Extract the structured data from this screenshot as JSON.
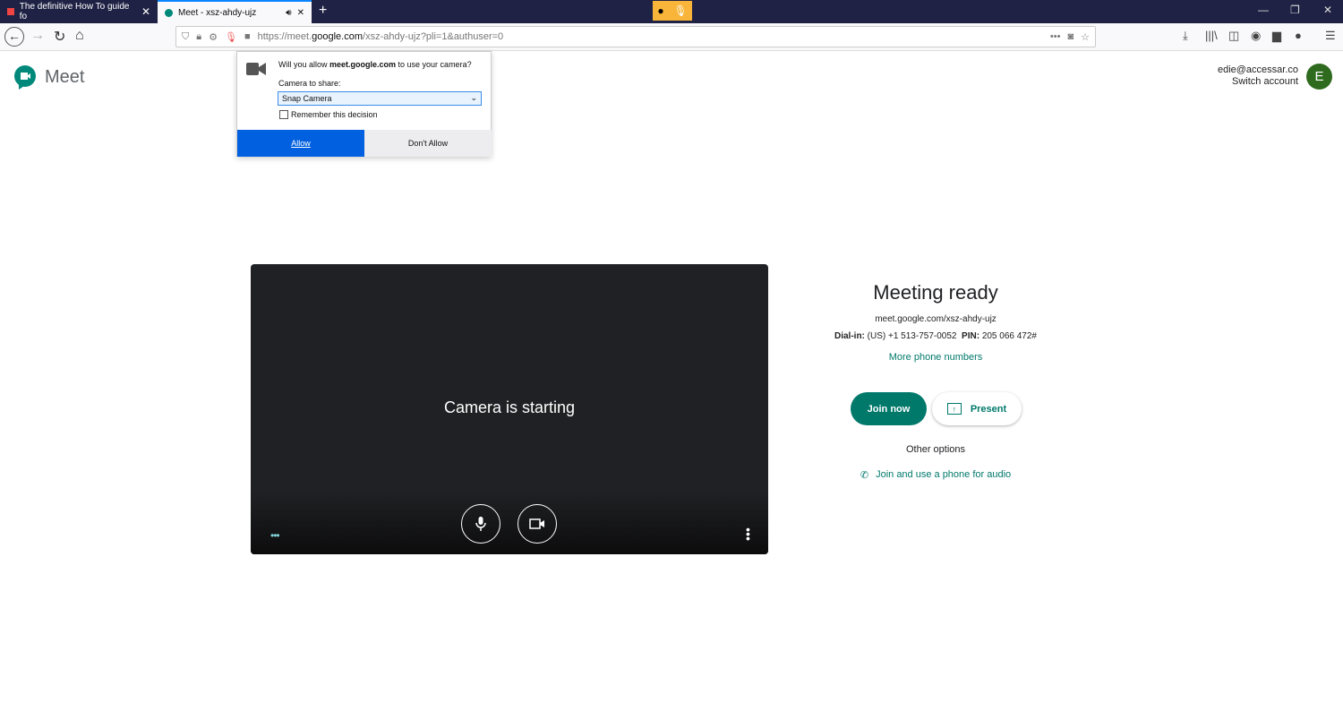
{
  "browser": {
    "tabs": [
      {
        "title": "The definitive How To guide fo"
      },
      {
        "title": "Meet - xsz-ahdy-ujz"
      }
    ],
    "url_prefix": "https://meet.",
    "url_domain": "google.com",
    "url_path": "/xsz-ahdy-ujz?pli=1&authuser=0"
  },
  "popup": {
    "question_pre": "Will you allow ",
    "question_domain": "meet.google.com",
    "question_post": " to use your camera?",
    "camera_label": "Camera to share:",
    "camera_value": "Snap Camera",
    "remember": "Remember this decision",
    "allow": "Allow",
    "deny": "Don't Allow"
  },
  "meet": {
    "logo": "Meet",
    "email": "edie@accessar.co",
    "switch": "Switch account",
    "avatar": "E",
    "camera_status": "Camera is starting",
    "title": "Meeting ready",
    "link": "meet.google.com/xsz-ahdy-ujz",
    "dial_label": "Dial-in:",
    "dial_number": "(US) +1 513-757-0052",
    "pin_label": "PIN:",
    "pin": "205 066 472#",
    "more_numbers": "More phone numbers",
    "join": "Join now",
    "present": "Present",
    "other_options": "Other options",
    "phone_audio": "Join and use a phone for audio"
  },
  "colors": {
    "accent": "#00796b",
    "allow": "#0060df",
    "tabbar": "#1f2244"
  }
}
